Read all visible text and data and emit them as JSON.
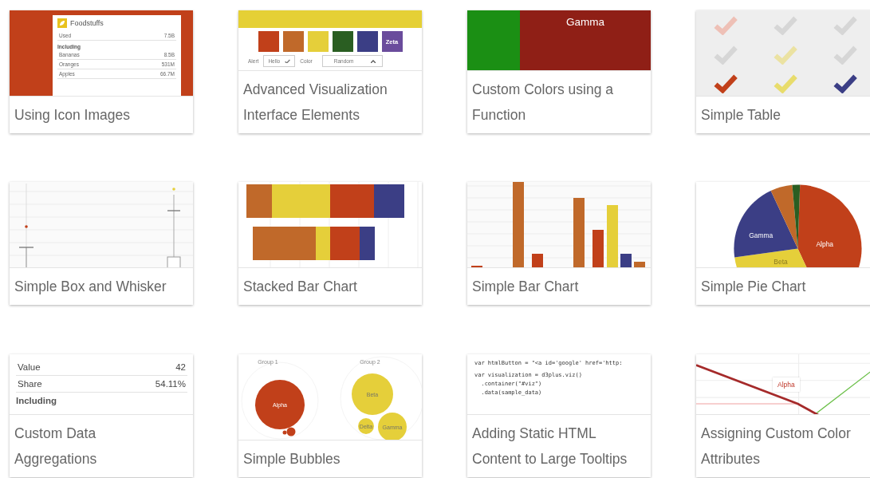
{
  "cards": [
    {
      "kind": "tooltip",
      "caption": "Using Icon Images",
      "tooltip": {
        "title": "Foodstuffs",
        "rows": [
          {
            "label": "Used",
            "value": "7.5B"
          }
        ],
        "section": "Including",
        "items": [
          {
            "label": "Bananas",
            "value": "8.5B"
          },
          {
            "label": "Oranges",
            "value": "531M"
          },
          {
            "label": "Apples",
            "value": "66.7M"
          }
        ]
      }
    },
    {
      "kind": "controls",
      "caption": "Advanced Visualization Interface Elements",
      "swatches": [
        {
          "color": "#c1401a"
        },
        {
          "color": "#c0692a"
        },
        {
          "color": "#e5cf3a"
        },
        {
          "color": "#2a5e22"
        },
        {
          "color": "#3b3e85"
        },
        {
          "color": "#6a4c9c",
          "label": "Zeta"
        }
      ],
      "alert_label": "Alert",
      "button": {
        "label": "Hello",
        "checked": true
      },
      "color_label": "Color",
      "select": "Random"
    },
    {
      "kind": "colors",
      "caption": "Custom Colors using a Function",
      "blocks": [
        {
          "color": "#1b8f14"
        },
        {
          "color": "#8f1f16",
          "label": "Gamma"
        }
      ]
    },
    {
      "kind": "icons",
      "caption": "Simple Table",
      "checks": [
        {
          "color": "#eec0b6"
        },
        {
          "color": "#d6d6d6"
        },
        {
          "color": "#d6d6d6"
        },
        {
          "color": "#d6d6d6"
        },
        {
          "color": "#ebe2a2"
        },
        {
          "color": "#d6d6d6"
        },
        {
          "color": "#c1401a"
        },
        {
          "color": "#e8dc6c"
        },
        {
          "color": "#3b3e85"
        }
      ]
    },
    {
      "kind": "boxplot",
      "caption": "Simple Box and Whisker"
    },
    {
      "kind": "stacked",
      "caption": "Stacked Bar Chart"
    },
    {
      "kind": "bars",
      "caption": "Simple Bar Chart"
    },
    {
      "kind": "pie",
      "caption": "Simple Pie Chart",
      "labels": [
        "Gamma",
        "Alpha",
        "Beta"
      ]
    },
    {
      "kind": "table",
      "caption": "Custom Data Aggregations",
      "rows": [
        {
          "label": "Value",
          "value": "42"
        },
        {
          "label": "Share",
          "value": "54.11%"
        }
      ],
      "section": "Including"
    },
    {
      "kind": "bubbles",
      "caption": "Simple Bubbles",
      "groups": [
        "Group 1",
        "Group 2"
      ],
      "bubbles": [
        "Alpha",
        "Beta",
        "Delta",
        "Gamma"
      ]
    },
    {
      "kind": "code",
      "caption": "Adding Static HTML Content to Large Tooltips",
      "blocks": [
        [
          "var htmlButton = \"<a id='google' href='http:"
        ],
        [
          "var visualization = d3plus.viz()",
          "  .container(\"#viz\")",
          "  .data(sample_data)"
        ]
      ]
    },
    {
      "kind": "lines",
      "caption": "Assigning Custom Color Attributes",
      "tooltip": "Alpha"
    }
  ]
}
